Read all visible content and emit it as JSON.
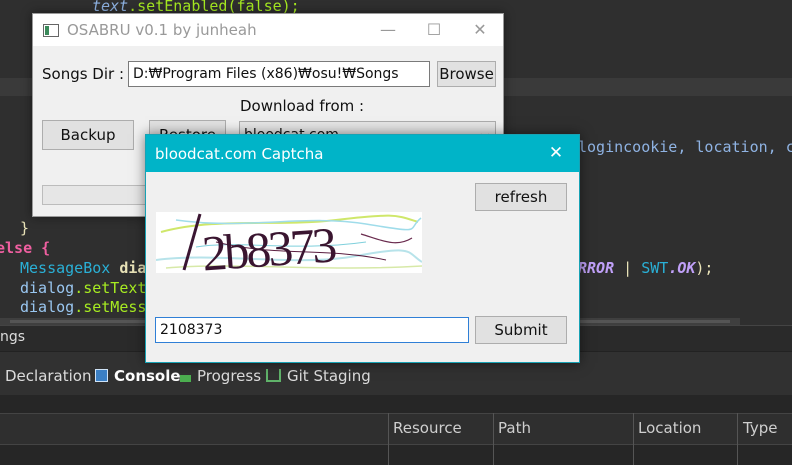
{
  "ide": {
    "code_top": ".setEnabled(false);",
    "code_top_obj": "text",
    "code_right": "logincookie, location, c",
    "code_close_brace": "}",
    "code_else": "else {",
    "code_mb_class": "MessageBox",
    "code_mb_var": "dia",
    "code_mb_tail_error": "RROR",
    "code_mb_tail_pipe": " | ",
    "code_mb_tail_swt": "SWT",
    "code_mb_tail_ok": ".OK",
    "code_mb_tail_end": ");",
    "code_dialog1_obj": "dialog",
    "code_dialog1_method": ".setText",
    "code_dialog2_obj": "dialog",
    "code_dialog2_method": ".setMess",
    "partial_tab": "ngs",
    "view_tabs": [
      "Declaration",
      "Console",
      "Progress",
      "Git Staging"
    ],
    "columns": [
      "Resource",
      "Path",
      "Location",
      "Type"
    ]
  },
  "osabru": {
    "title": "OSABRU v0.1 by junheah",
    "songs_dir_label": "Songs Dir :",
    "songs_dir_value": "D:₩Program Files (x86)₩osu!₩Songs",
    "browse_label": "Browse",
    "download_from_label": "Download from :",
    "backup_label": "Backup",
    "restore_label": "Restore",
    "download_source": "bloodcat.com",
    "window_buttons": {
      "minimize": "—",
      "maximize": "☐",
      "close": "✕"
    }
  },
  "captcha": {
    "title": "bloodcat.com Captcha",
    "close": "✕",
    "refresh_label": "refresh",
    "captcha_text": "2b8373",
    "input_value": "2108373",
    "submit_label": "Submit"
  },
  "colors": {
    "captcha_titlebar": "#00b4c8",
    "ide_background": "#2b2b2b"
  }
}
